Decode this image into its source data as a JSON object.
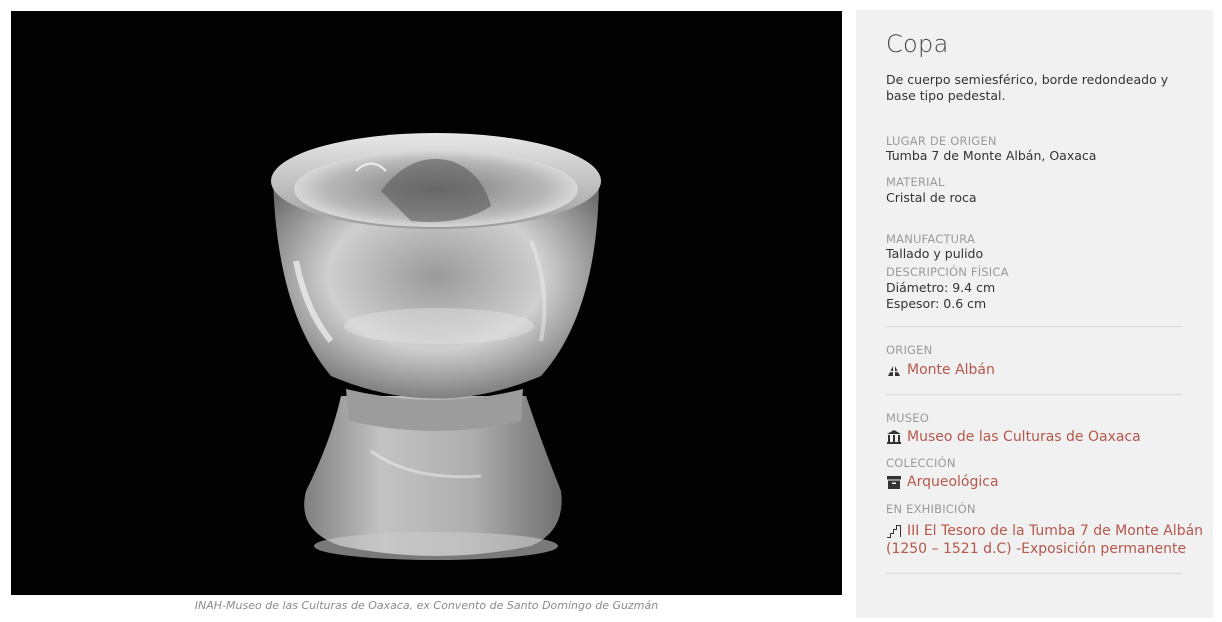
{
  "image": {
    "caption": "INAH-Museo de las Culturas de Oaxaca, ex Convento de Santo Domingo de Guzmán"
  },
  "object": {
    "title": "Copa",
    "description": "De cuerpo semiesférico, borde redondeado y base tipo pedestal."
  },
  "details": {
    "lugar_label": "LUGAR DE ORIGEN",
    "lugar_value": "Tumba 7 de Monte Albán, Oaxaca",
    "material_label": "MATERIAL",
    "material_value": "Cristal de roca",
    "manufactura_label": "MANUFACTURA",
    "manufactura_value": "Tallado y pulido",
    "descripcion_label": "DESCRIPCIÓN FÍSICA",
    "descripcion_line1": "Diámetro: 9.4 cm",
    "descripcion_line2": "Espesor: 0.6 cm"
  },
  "origen": {
    "label": "ORIGEN",
    "link": "Monte Albán",
    "icon": "pyramid-icon"
  },
  "museo": {
    "label": "MUSEO",
    "link": "Museo de las Culturas de Oaxaca",
    "icon": "museum-icon"
  },
  "coleccion": {
    "label": "COLECCIÓN",
    "link": "Arqueológica",
    "icon": "archive-box-icon"
  },
  "exhibicion": {
    "label": "EN EXHIBICIÓN",
    "link_line1": "III El Tesoro de la Tumba 7 de Monte Albán",
    "link_line2": "(1250 – 1521 d.C) -Exposición permanente",
    "icon": "exhibition-stairs-icon"
  },
  "colors": {
    "link": "#b5574a",
    "panel_bg": "#f1f1f1",
    "photo_bg": "#020202"
  }
}
